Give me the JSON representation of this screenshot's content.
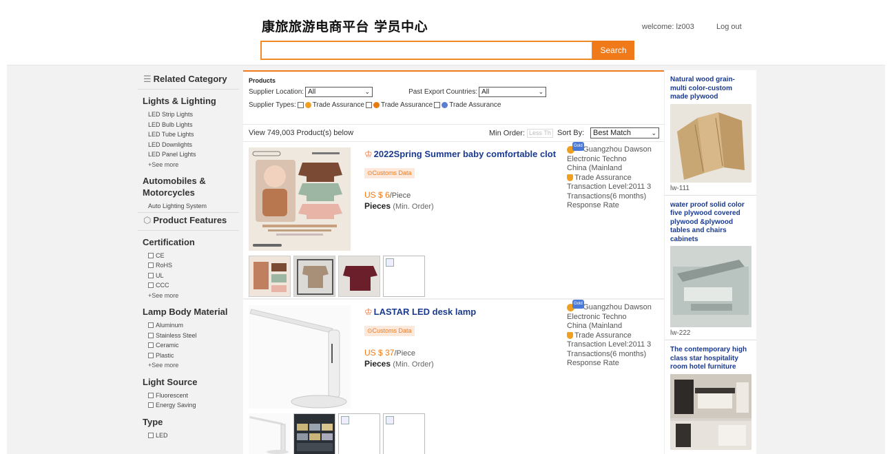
{
  "header": {
    "site_title": "康旅旅游电商平台 学员中心",
    "welcome": "welcome: lz003",
    "logout": "Log out",
    "search_value": "",
    "search_button": "Search"
  },
  "sidebar": {
    "related_category": "Related Category",
    "groups": [
      {
        "title": "Lights & Lighting",
        "items": [
          "LED Strip Lights",
          "LED Bulb Lights",
          "LED Tube Lights",
          "LED Downlights",
          "LED Panel Lights",
          "+See more"
        ]
      },
      {
        "title": "Automobiles & Motorcycles",
        "items": [
          "Auto Lighting System"
        ]
      }
    ],
    "product_features": "Product Features",
    "feature_groups": [
      {
        "title": "Certification",
        "options": [
          "CE",
          "RoHS",
          "UL",
          "CCC"
        ],
        "more": "+See more"
      },
      {
        "title": "Lamp Body Material",
        "options": [
          "Aluminum",
          "Stainless Steel",
          "Ceramic",
          "Plastic"
        ],
        "more": "+See more"
      },
      {
        "title": "Light Source",
        "options": [
          "Fluorescent",
          "Energy Saving"
        ],
        "more": ""
      },
      {
        "title": "Type",
        "options": [
          "LED"
        ],
        "more": ""
      }
    ]
  },
  "filters": {
    "title": "Products",
    "supplier_location_label": "Supplier Location:",
    "supplier_location_value": "All",
    "past_export_label": "Past Export Countries:",
    "past_export_value": "All",
    "supplier_types_label": "Supplier Types:",
    "supplier_types": [
      "Trade Assurance",
      "Trade Assurance",
      "Trade Assurance"
    ]
  },
  "results": {
    "count_text": "View 749,003 Product(s) below",
    "min_order_label": "Min Order:",
    "min_order_placeholder": "Less Th",
    "sort_label": "Sort By:",
    "sort_value": "Best Match"
  },
  "products": [
    {
      "title": "2022Spring Summer baby comfortable clot",
      "customs": "Customs Data",
      "price": "US $ 6",
      "price_unit": "/Piece",
      "moq": "Pieces",
      "moq_label": "(Min. Order)",
      "supplier_name": "Guangzhou Dawson Electronic Techno",
      "supplier_country": "China (Mainland",
      "trade_assurance": "Trade Assurance",
      "transaction_level": "Transaction Level:2011 3",
      "transactions": "Transactions(6 months)",
      "response_rate": "Response Rate"
    },
    {
      "title": "LASTAR LED desk lamp",
      "customs": "Customs Data",
      "price": "US $ 37",
      "price_unit": "/Piece",
      "moq": "Pieces",
      "moq_label": "(Min. Order)",
      "supplier_name": "Guangzhou Dawson Electronic Techno",
      "supplier_country": "China (Mainland",
      "trade_assurance": "Trade Assurance",
      "transaction_level": "Transaction Level:2011 3",
      "transactions": "Transactions(6 months)",
      "response_rate": "Response Rate"
    }
  ],
  "ads": [
    {
      "title": "Natural wood grain-multi color-custom made plywood",
      "code": "lw-111"
    },
    {
      "title": "water proof solid color five plywood covered plywood &plywood tables and chairs cabinets",
      "code": "lw-222"
    },
    {
      "title": "The contemporary high class star hospitality room hotel furniture",
      "code": ""
    }
  ],
  "colors": {
    "accent": "#f07a1a",
    "link": "#1a3a8f",
    "band": "#f2f2f2"
  }
}
